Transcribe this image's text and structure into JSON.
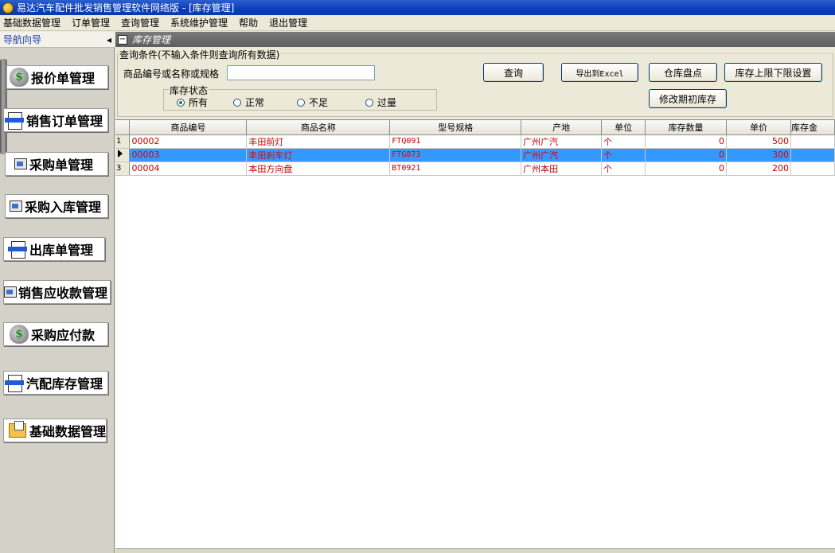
{
  "window": {
    "title": "易达汽车配件批发销售管理软件网络版  - [库存管理]"
  },
  "menu": [
    "基础数据管理",
    "订单管理",
    "查询管理",
    "系统维护管理",
    "帮助",
    "退出管理"
  ],
  "nav": {
    "header": "导航向导",
    "collapse_glyph": "◂",
    "items": [
      {
        "label": "报价单管理",
        "icon": "money-bag-icon"
      },
      {
        "label": "销售订单管理",
        "icon": "document-arrows-icon"
      },
      {
        "label": "采购单管理",
        "icon": "form-icon"
      },
      {
        "label": "采购入库管理",
        "icon": "form-icon"
      },
      {
        "label": "出库单管理",
        "icon": "document-arrows-icon"
      },
      {
        "label": "销售应收款管理",
        "icon": "form-icon"
      },
      {
        "label": "采购应付款",
        "icon": "money-bag-icon"
      },
      {
        "label": "汽配库存管理",
        "icon": "document-arrows-icon"
      },
      {
        "label": "基础数据管理",
        "icon": "folder-icon"
      }
    ]
  },
  "panel": {
    "title": "库存管理",
    "collapse_glyph": "−"
  },
  "query": {
    "legend": "查询条件(不输入条件则查询所有数据)",
    "field_label": "商品编号或名称或规格",
    "field_value": "",
    "status_label": "库存状态",
    "status_options": [
      "所有",
      "正常",
      "不足",
      "过量"
    ],
    "status_selected": "所有",
    "buttons": {
      "query": "查询",
      "export": "导出到Excel",
      "stocktake": "仓库盘点",
      "limits": "库存上限下限设置",
      "initial": "修改期初库存"
    }
  },
  "table": {
    "columns": [
      "商品编号",
      "商品名称",
      "型号规格",
      "产地",
      "单位",
      "库存数量",
      "单价",
      "库存金"
    ],
    "rows": [
      {
        "rowhdr": "1",
        "code": "00002",
        "name": "丰田前灯",
        "spec": "FTQ091",
        "origin": "广州广汽",
        "unit": "个",
        "qty": "0",
        "price": "500",
        "amount": ""
      },
      {
        "rowhdr": "",
        "code": "00003",
        "name": "丰田刹车灯",
        "spec": "FTG873",
        "origin": "广州广汽",
        "unit": "个",
        "qty": "0",
        "price": "300",
        "amount": ""
      },
      {
        "rowhdr": "3",
        "code": "00004",
        "name": "本田方向盘",
        "spec": "BT0921",
        "origin": "广州本田",
        "unit": "个",
        "qty": "0",
        "price": "200",
        "amount": ""
      }
    ],
    "selected_row": 1
  },
  "colors": {
    "title_bar": "#0a3db8",
    "selection": "#3399ff",
    "cell_text": "#c00000"
  }
}
